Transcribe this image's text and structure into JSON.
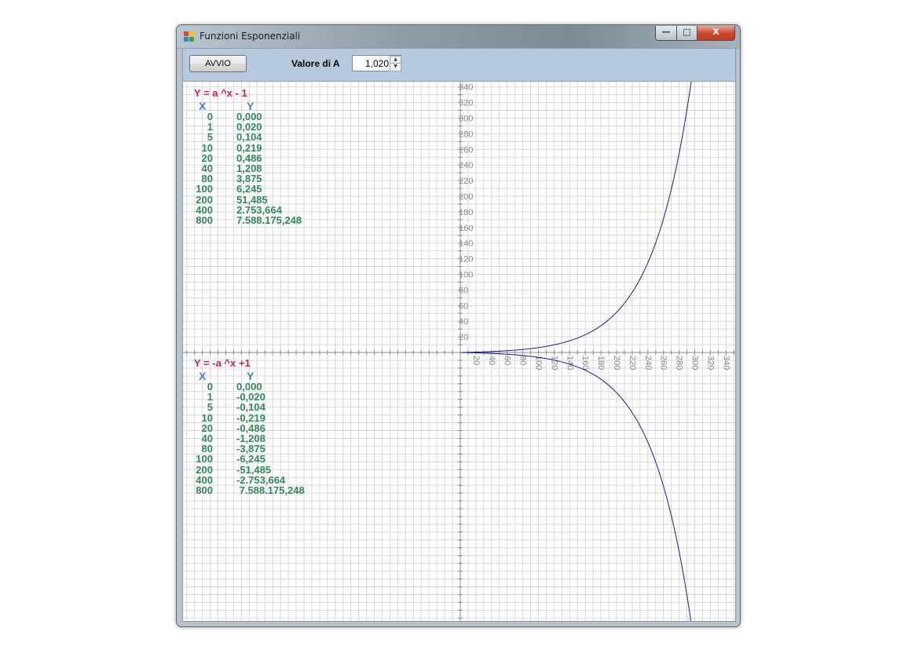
{
  "window": {
    "title": "Funzioni Esponenziali"
  },
  "controls": {
    "minimize": "—",
    "maximize": "□",
    "close": "X"
  },
  "toolbar": {
    "start_label": "AVVIO",
    "a_label": "Valore di A",
    "a_value": "1,020"
  },
  "table_top": {
    "formula": "Y = a ^x - 1",
    "x_header": "X",
    "y_header": "Y",
    "rows": [
      {
        "x": "0",
        "y": "0,000"
      },
      {
        "x": "1",
        "y": "0,020"
      },
      {
        "x": "5",
        "y": "0,104"
      },
      {
        "x": "10",
        "y": "0,219"
      },
      {
        "x": "20",
        "y": "0,486"
      },
      {
        "x": "40",
        "y": "1,208"
      },
      {
        "x": "80",
        "y": "3,875"
      },
      {
        "x": "100",
        "y": "6,245"
      },
      {
        "x": "200",
        "y": "51,485"
      },
      {
        "x": "400",
        "y": "2.753,664"
      },
      {
        "x": "800",
        "y": "7.588.175,248"
      }
    ]
  },
  "table_bottom": {
    "formula": "Y = -a ^x +1",
    "x_header": "X",
    "y_header": "Y",
    "rows": [
      {
        "x": "0",
        "y": "0,000"
      },
      {
        "x": "1",
        "y": "-0,020"
      },
      {
        "x": "5",
        "y": "-0,104"
      },
      {
        "x": "10",
        "y": "-0,219"
      },
      {
        "x": "20",
        "y": "-0,486"
      },
      {
        "x": "40",
        "y": "-1,208"
      },
      {
        "x": "80",
        "y": "-3,875"
      },
      {
        "x": "100",
        "y": "-6,245"
      },
      {
        "x": "200",
        "y": "-51,485"
      },
      {
        "x": "400",
        "y": "-2.753,664"
      },
      {
        "x": "800",
        "y": " 7.588.175,248"
      }
    ]
  },
  "chart_data": {
    "type": "line",
    "a": 1.02,
    "series": [
      {
        "name": "Y = a ^x - 1",
        "sign": 1
      },
      {
        "name": "Y = -a ^x +1",
        "sign": -1
      }
    ],
    "y_ticks": [
      20,
      40,
      60,
      80,
      100,
      120,
      140,
      160,
      180,
      200,
      220,
      240,
      260,
      280,
      300,
      320,
      340
    ],
    "x_ticks": [
      20,
      40,
      60,
      80,
      100,
      120,
      140,
      160,
      180,
      200,
      220,
      240,
      260,
      280,
      300,
      320,
      340
    ],
    "xlim": [
      0,
      345
    ],
    "ylim": [
      -345,
      345
    ],
    "grid": true,
    "colors": {
      "curve": "#1a1aa6",
      "grid": "#d9d9d9",
      "axis": "#8a8a8a",
      "tick_label": "#8a8a8a"
    }
  }
}
